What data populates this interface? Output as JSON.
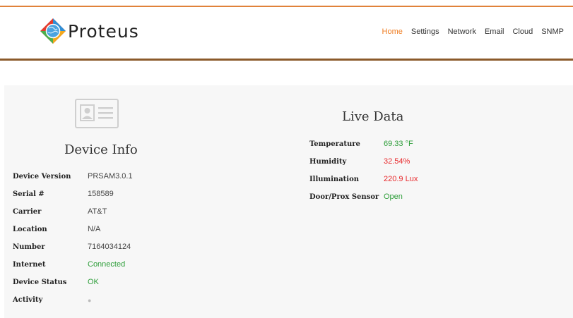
{
  "brand": {
    "name": "Proteus",
    "logo_icon": "proteus-globe-logo-icon"
  },
  "nav": {
    "items": [
      {
        "label": "Home",
        "active": true
      },
      {
        "label": "Settings",
        "active": false
      },
      {
        "label": "Network",
        "active": false
      },
      {
        "label": "Email",
        "active": false
      },
      {
        "label": "Cloud",
        "active": false
      },
      {
        "label": "SNMP",
        "active": false
      }
    ]
  },
  "device_info": {
    "title": "Device Info",
    "icon": "id-card-icon",
    "rows": [
      {
        "label": "Device Version",
        "value": "PRSAM3.0.1"
      },
      {
        "label": "Serial #",
        "value": "158589"
      },
      {
        "label": "Carrier",
        "value": "AT&T"
      },
      {
        "label": "Location",
        "value": "N/A"
      },
      {
        "label": "Number",
        "value": "7164034124"
      },
      {
        "label": "Internet",
        "value": "Connected"
      },
      {
        "label": "Device Status",
        "value": "OK"
      },
      {
        "label": "Activity",
        "value": "●"
      }
    ]
  },
  "live_data": {
    "title": "Live Data",
    "rows": [
      {
        "label": "Temperature",
        "value": "69.33 °F"
      },
      {
        "label": "Humidity",
        "value": "32.54%"
      },
      {
        "label": "Illumination",
        "value": "220.9 Lux"
      },
      {
        "label": "Door/Prox Sensor",
        "value": "Open"
      }
    ]
  },
  "colors": {
    "accent": "#ef7d22",
    "status_ok": "#2e9e3a",
    "status_alert": "#e8282b",
    "header_bottom_border": "#8b5a2b",
    "panel_bg": "#f7f7f7"
  }
}
